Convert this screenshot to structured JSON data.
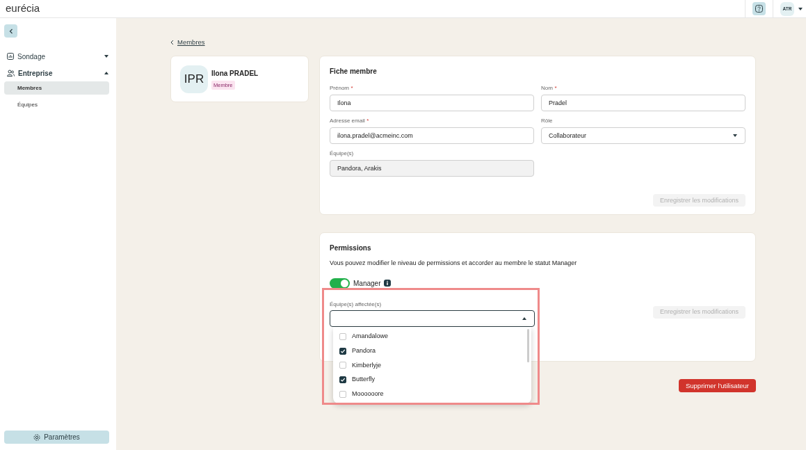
{
  "topbar": {
    "logo": "eurécia",
    "avatar": "ATR"
  },
  "sidebar": {
    "items": [
      {
        "label": "Sondage",
        "expanded": false
      },
      {
        "label": "Entreprise",
        "expanded": true,
        "children": [
          {
            "label": "Membres",
            "selected": true
          },
          {
            "label": "Équipes",
            "selected": false
          }
        ]
      }
    ],
    "settings": "Paramètres"
  },
  "breadcrumb": "Membres",
  "profile": {
    "initials": "IPR",
    "name": "Ilona PRADEL",
    "badge": "Membre"
  },
  "fiche": {
    "title": "Fiche membre",
    "fields": [
      {
        "kind": "text",
        "label": "Prénom",
        "required_mark": "*",
        "value": "Ilona"
      },
      {
        "kind": "text",
        "label": "Nom",
        "required_mark": "*",
        "value": "Pradel"
      },
      {
        "kind": "text",
        "label": "Adresse email",
        "required_mark": "*",
        "value": "ilona.pradel@acmeinc.com"
      },
      {
        "kind": "select",
        "label": "Rôle",
        "value": "Collaborateur"
      },
      {
        "kind": "readonly",
        "label": "Équipe(s)",
        "value": "Pandora, Arakis"
      }
    ],
    "save": {
      "label": "Enregistrer les modifications",
      "disabled": true
    }
  },
  "permissions": {
    "title": "Permissions",
    "description": "Vous pouvez modifier le niveau de permissions et accorder au membre le statut Manager",
    "toggle": {
      "label": "Manager",
      "on": true
    },
    "teams": {
      "label": "Équipe(s) affectée(s)",
      "expanded": true,
      "options": [
        {
          "label": "Amandalowe",
          "checked": false
        },
        {
          "label": "Pandora",
          "checked": true
        },
        {
          "label": "Kimberlyje",
          "checked": false
        },
        {
          "label": "Butterfly",
          "checked": true
        },
        {
          "label": "Moooooore",
          "checked": false
        }
      ]
    },
    "save": {
      "label": "Enregistrer les modifications",
      "disabled": true
    }
  },
  "delete_button": "Supprimer l'utilisateur"
}
